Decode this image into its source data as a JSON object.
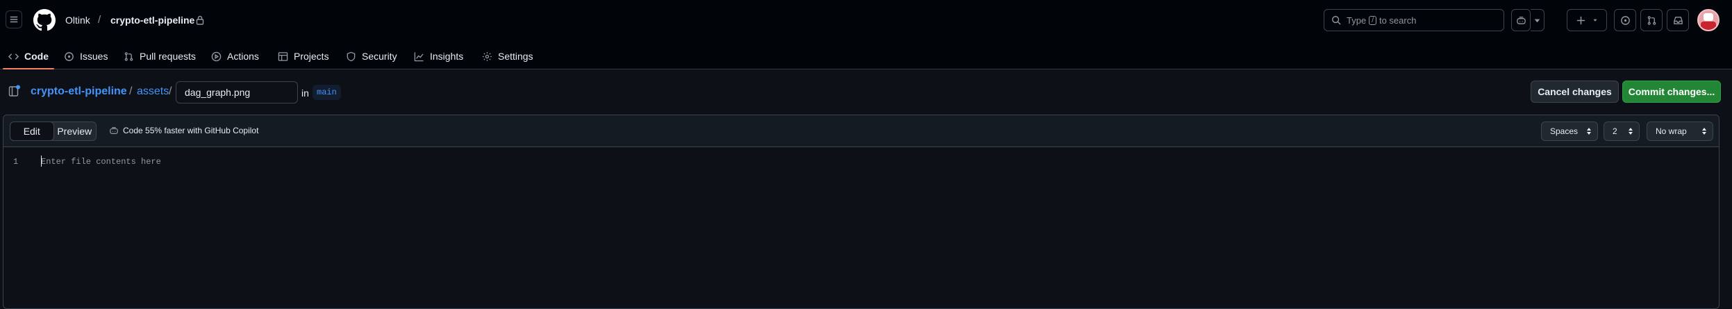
{
  "header": {
    "owner": "Oltink",
    "separator": "/",
    "repo": "crypto-etl-pipeline",
    "search": {
      "placeholder_prefix": "Type",
      "key": "/",
      "placeholder_suffix": "to search"
    }
  },
  "tabs": [
    {
      "label": "Code",
      "icon": "code-icon",
      "active": true
    },
    {
      "label": "Issues",
      "icon": "issue-icon"
    },
    {
      "label": "Pull requests",
      "icon": "pull-request-icon"
    },
    {
      "label": "Actions",
      "icon": "play-icon"
    },
    {
      "label": "Projects",
      "icon": "table-icon"
    },
    {
      "label": "Security",
      "icon": "shield-icon"
    },
    {
      "label": "Insights",
      "icon": "graph-icon"
    },
    {
      "label": "Settings",
      "icon": "gear-icon"
    }
  ],
  "filebar": {
    "repo_link": "crypto-etl-pipeline",
    "sep": "/",
    "dir_link": "assets",
    "filename": "dag_graph.png",
    "in_label": "in",
    "branch": "main",
    "cancel_label": "Cancel changes",
    "commit_label": "Commit changes..."
  },
  "editor": {
    "edit_label": "Edit",
    "preview_label": "Preview",
    "copilot_text": "Code 55% faster with GitHub Copilot",
    "indent_mode": "Spaces",
    "indent_size": "2",
    "wrap_mode": "No wrap",
    "line_number": "1",
    "placeholder": "Enter file contents here"
  },
  "colors": {
    "accent_link": "#4493f8",
    "commit_green": "#238636",
    "active_tab_underline": "#f78166"
  }
}
